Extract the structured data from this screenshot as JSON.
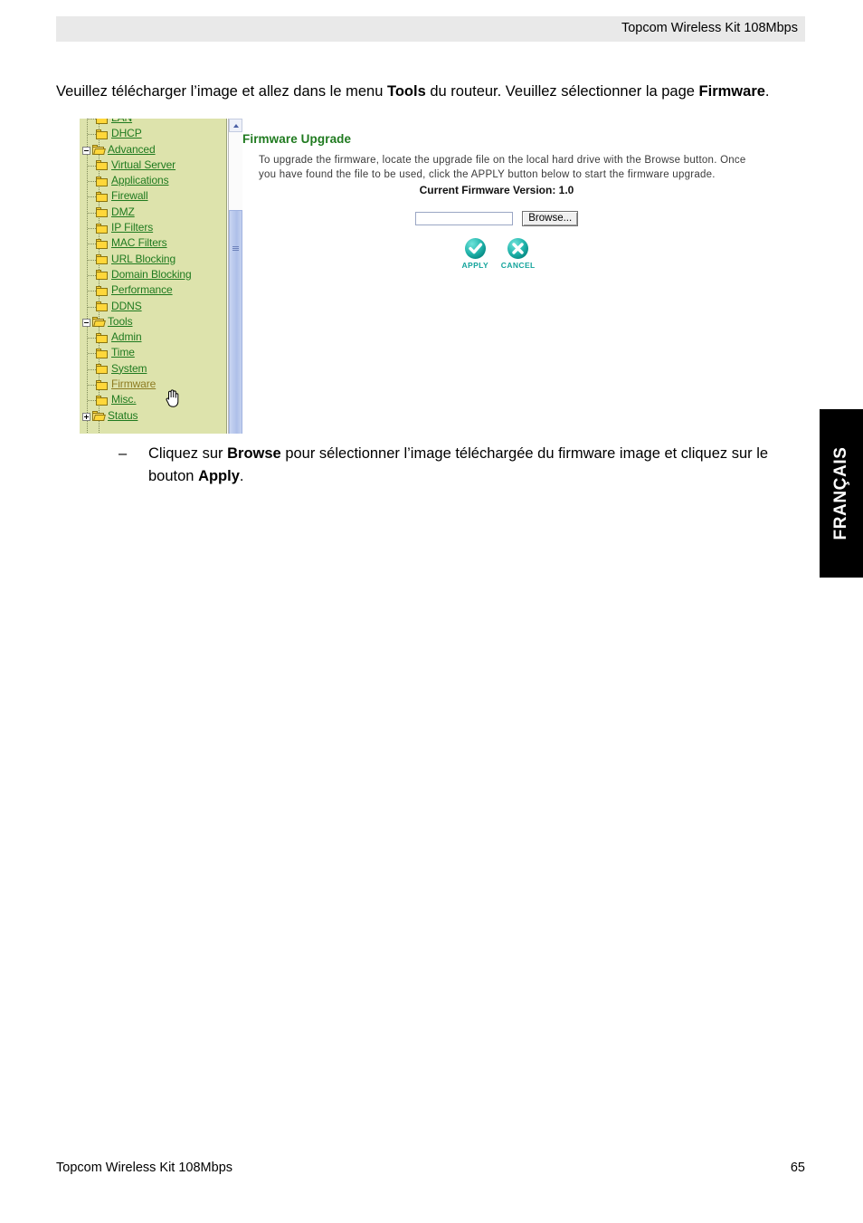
{
  "header": {
    "title": "Topcom Wireless Kit 108Mbps"
  },
  "intro": {
    "part1": "Veuillez télécharger l’image et allez dans le menu ",
    "bold1": "Tools",
    "part2": " du routeur. Veuillez sélectionner la page ",
    "bold2": "Firmware",
    "part3": "."
  },
  "screenshot": {
    "tree": {
      "items": [
        {
          "label": "LAN",
          "depth": 1,
          "expander": "none",
          "folder": "closed",
          "state": "normal"
        },
        {
          "label": "DHCP",
          "depth": 1,
          "expander": "none",
          "folder": "closed",
          "state": "normal"
        },
        {
          "label": "Advanced",
          "depth": 0,
          "expander": "minus",
          "folder": "open",
          "state": "normal"
        },
        {
          "label": "Virtual Server",
          "depth": 1,
          "expander": "none",
          "folder": "closed",
          "state": "normal"
        },
        {
          "label": "Applications",
          "depth": 1,
          "expander": "none",
          "folder": "closed",
          "state": "normal"
        },
        {
          "label": "Firewall",
          "depth": 1,
          "expander": "none",
          "folder": "closed",
          "state": "normal"
        },
        {
          "label": "DMZ",
          "depth": 1,
          "expander": "none",
          "folder": "closed",
          "state": "normal"
        },
        {
          "label": "IP Filters",
          "depth": 1,
          "expander": "none",
          "folder": "closed",
          "state": "normal"
        },
        {
          "label": "MAC Filters",
          "depth": 1,
          "expander": "none",
          "folder": "closed",
          "state": "normal"
        },
        {
          "label": "URL Blocking",
          "depth": 1,
          "expander": "none",
          "folder": "closed",
          "state": "normal"
        },
        {
          "label": "Domain Blocking",
          "depth": 1,
          "expander": "none",
          "folder": "closed",
          "state": "normal"
        },
        {
          "label": "Performance",
          "depth": 1,
          "expander": "none",
          "folder": "closed",
          "state": "normal"
        },
        {
          "label": "DDNS",
          "depth": 1,
          "expander": "none",
          "folder": "closed",
          "state": "normal"
        },
        {
          "label": "Tools",
          "depth": 0,
          "expander": "minus",
          "folder": "open",
          "state": "normal"
        },
        {
          "label": "Admin",
          "depth": 1,
          "expander": "none",
          "folder": "closed",
          "state": "normal"
        },
        {
          "label": "Time",
          "depth": 1,
          "expander": "none",
          "folder": "closed",
          "state": "normal"
        },
        {
          "label": "System",
          "depth": 1,
          "expander": "none",
          "folder": "closed",
          "state": "normal"
        },
        {
          "label": "Firmware",
          "depth": 1,
          "expander": "none",
          "folder": "closed",
          "state": "hover"
        },
        {
          "label": "Misc.",
          "depth": 1,
          "expander": "none",
          "folder": "closed",
          "state": "normal"
        },
        {
          "label": "Status",
          "depth": 0,
          "expander": "plus",
          "folder": "open",
          "state": "normal"
        }
      ],
      "link_color": "#1f7a1f",
      "hover_color": "#8d7b21",
      "background": "#dde3ac"
    },
    "panel": {
      "title": "Firmware Upgrade",
      "description": "To upgrade the firmware, locate the upgrade file on the local hard drive with the Browse button. Once you have found the file to be used, click the APPLY button below to start the firmware upgrade.",
      "version_line": "Current Firmware Version: 1.0",
      "file_input_value": "",
      "browse_label": "Browse...",
      "apply_label": "APPLY",
      "cancel_label": "CANCEL",
      "title_color": "#1f7a1f",
      "button_color": "#14a49c"
    }
  },
  "bullet": {
    "dash": "–",
    "part1": "Cliquez sur ",
    "bold1": "Browse",
    "part2": " pour sélectionner l’image téléchargée du firmware image et cliquez sur le bouton ",
    "bold2": "Apply",
    "part3": "."
  },
  "language_tab": {
    "label": "FRANÇAIS"
  },
  "footer": {
    "left": "Topcom Wireless Kit 108Mbps",
    "right": "65"
  }
}
